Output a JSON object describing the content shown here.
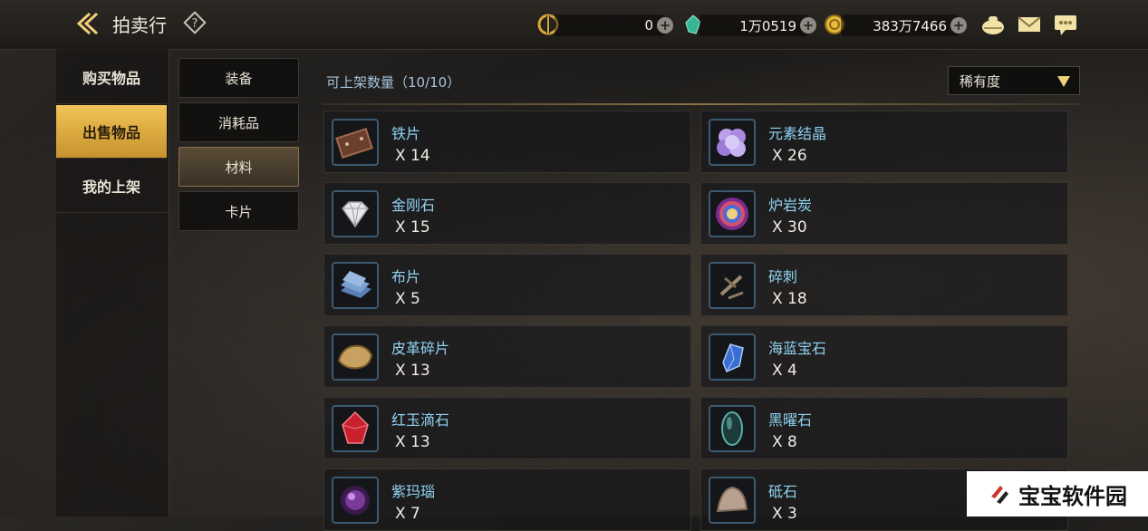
{
  "header": {
    "title": "拍卖行",
    "back_icon": "back-arrow-icon",
    "help_icon": "help-icon"
  },
  "currencies": [
    {
      "icon": "c-coin-icon",
      "value": "0"
    },
    {
      "icon": "green-gem-icon",
      "value": "1万0519"
    },
    {
      "icon": "gold-coin-icon",
      "value": "383万7466"
    }
  ],
  "top_icons": [
    "bag-icon",
    "mail-icon",
    "chat-icon"
  ],
  "nav": {
    "items": [
      {
        "label": "购买物品",
        "active": false
      },
      {
        "label": "出售物品",
        "active": true
      },
      {
        "label": "我的上架",
        "active": false
      }
    ]
  },
  "subcats": {
    "items": [
      {
        "label": "装备",
        "active": false
      },
      {
        "label": "消耗品",
        "active": false
      },
      {
        "label": "材料",
        "active": true
      },
      {
        "label": "卡片",
        "active": false
      }
    ]
  },
  "listing": {
    "count_label": "可上架数量（10/10）",
    "sort_value": "稀有度"
  },
  "items": [
    {
      "name": "铁片",
      "qty": "X 14",
      "icon": "iron-plate-icon"
    },
    {
      "name": "元素结晶",
      "qty": "X 26",
      "icon": "element-crystal-icon"
    },
    {
      "name": "金刚石",
      "qty": "X 15",
      "icon": "diamond-icon"
    },
    {
      "name": "炉岩炭",
      "qty": "X 30",
      "icon": "furnace-coal-icon"
    },
    {
      "name": "布片",
      "qty": "X 5",
      "icon": "cloth-icon"
    },
    {
      "name": "碎刺",
      "qty": "X 18",
      "icon": "thorn-fragment-icon"
    },
    {
      "name": "皮革碎片",
      "qty": "X 13",
      "icon": "leather-scrap-icon"
    },
    {
      "name": "海蓝宝石",
      "qty": "X 4",
      "icon": "aquamarine-icon"
    },
    {
      "name": "红玉滴石",
      "qty": "X 13",
      "icon": "ruby-drop-icon"
    },
    {
      "name": "黑曜石",
      "qty": "X 8",
      "icon": "obsidian-icon"
    },
    {
      "name": "紫玛瑙",
      "qty": "X 7",
      "icon": "purple-agate-icon"
    },
    {
      "name": "砥石",
      "qty": "X 3",
      "icon": "whetstone-icon"
    }
  ],
  "watermark": {
    "text": "宝宝软件园"
  },
  "colors": {
    "accent": "#e8b94a",
    "item_name": "#8fd3f2",
    "count_label": "#a5c2dc"
  }
}
